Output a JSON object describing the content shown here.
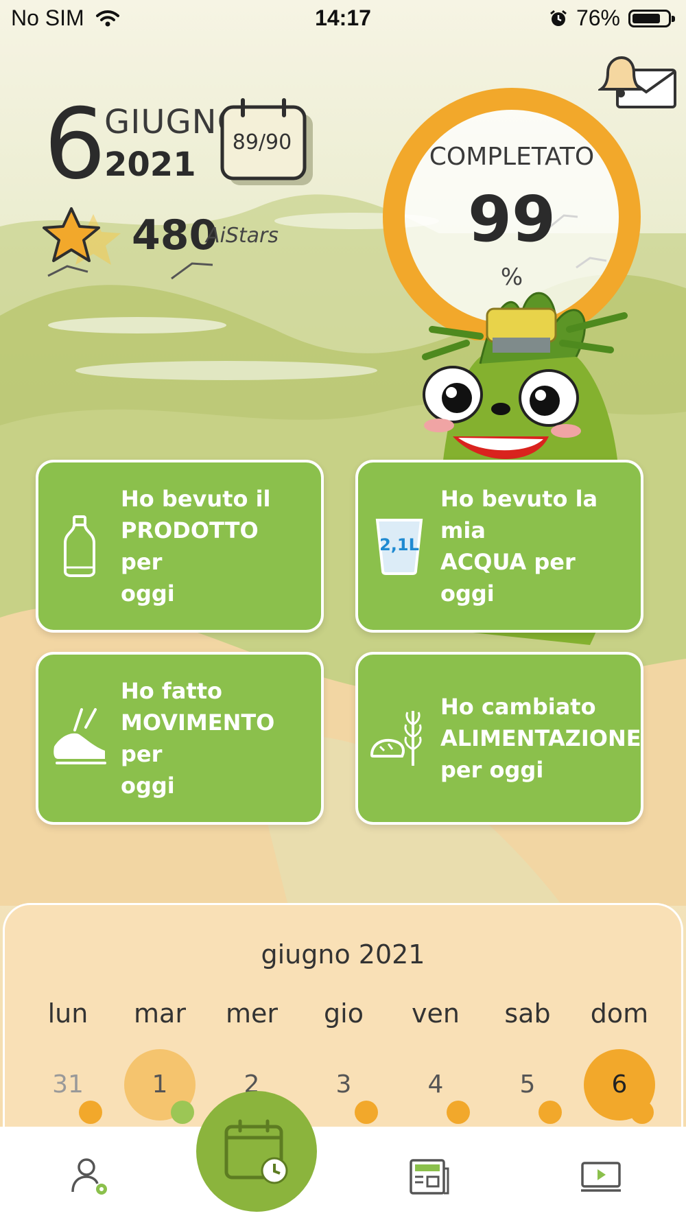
{
  "status_bar": {
    "carrier": "No SIM",
    "time": "14:17",
    "battery": "76%",
    "battery_level": 0.76
  },
  "header": {
    "day": "6",
    "month": "GIUGNO",
    "year": "2021",
    "progress_days": "89/90",
    "stars_value": "480",
    "stars_label": "AiStars"
  },
  "progress": {
    "label": "COMPLETATO",
    "value": "99",
    "unit": "%",
    "fraction": 0.99
  },
  "actions": [
    {
      "label_lines": [
        "Ho bevuto il",
        "PRODOTTO per",
        "oggi"
      ],
      "icon": "bottle-icon"
    },
    {
      "label_lines": [
        "Ho bevuto la mia",
        "ACQUA per oggi"
      ],
      "icon": "water-glass-icon",
      "icon_text": "2,1L"
    },
    {
      "label_lines": [
        "Ho fatto",
        "MOVIMENTO per",
        "oggi"
      ],
      "icon": "sneaker-icon"
    },
    {
      "label_lines": [
        "Ho cambiato",
        "ALIMENTAZIONE",
        "per oggi"
      ],
      "icon": "bread-wheat-icon"
    }
  ],
  "calendar": {
    "month_title": "giugno 2021",
    "weekdays": [
      "lun",
      "mar",
      "mer",
      "gio",
      "ven",
      "sab",
      "dom"
    ],
    "days": [
      "31",
      "1",
      "2",
      "3",
      "4",
      "5",
      "6"
    ]
  },
  "nav": {
    "items": [
      "profile-settings-icon",
      "calendar-clock-icon",
      "news-icon",
      "video-icon"
    ]
  },
  "colors": {
    "green": "#8bc04c",
    "orange": "#f2a82b",
    "panel": "#f9e0b6"
  }
}
